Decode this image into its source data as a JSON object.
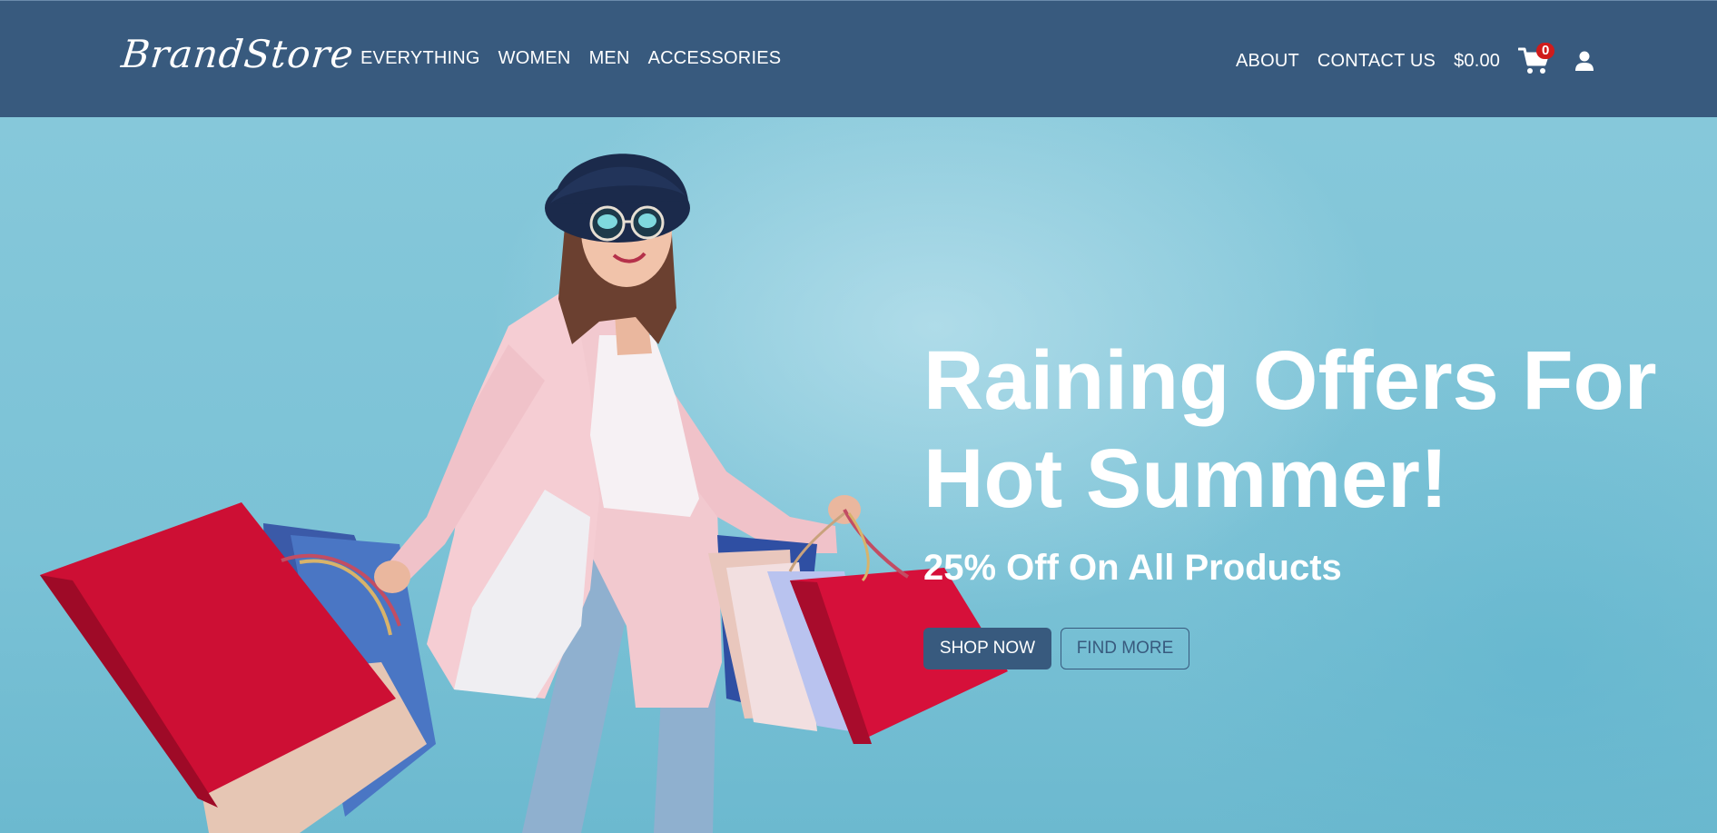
{
  "header": {
    "logo_text": "BrandStore",
    "nav_left": [
      {
        "label": "EVERYTHING"
      },
      {
        "label": "WOMEN"
      },
      {
        "label": "MEN"
      },
      {
        "label": "ACCESSORIES"
      }
    ],
    "nav_right": {
      "about": "ABOUT",
      "contact": "CONTACT US",
      "cart_total": "$0.00",
      "cart_count": "0",
      "cart_icon": "shopping-cart-icon",
      "user_icon": "user-icon"
    }
  },
  "hero": {
    "title": "Raining Offers For Hot Summer!",
    "subtitle": "25% Off On All Products",
    "primary_button": "SHOP NOW",
    "secondary_button": "FIND MORE",
    "image": "woman-with-shopping-bags"
  },
  "colors": {
    "header_bg": "#385a7e",
    "hero_bg": "#7cc3d6",
    "accent_red": "#d01b1b",
    "text_white": "#ffffff"
  }
}
